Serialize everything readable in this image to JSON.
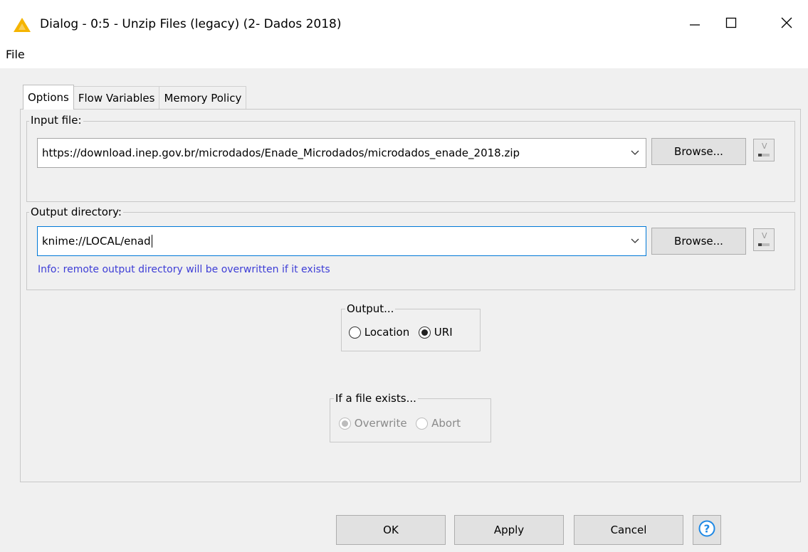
{
  "window": {
    "title": "Dialog - 0:5 - Unzip Files (legacy) (2- Dados 2018)"
  },
  "menu": {
    "file_label": "File"
  },
  "tabs": [
    {
      "label": "Options",
      "active": true
    },
    {
      "label": "Flow Variables",
      "active": false
    },
    {
      "label": "Memory Policy",
      "active": false
    }
  ],
  "input_file": {
    "group_label": "Input file:",
    "value": "https://download.inep.gov.br/microdados/Enade_Microdados/microdados_enade_2018.zip",
    "browse_label": "Browse..."
  },
  "output_directory": {
    "group_label": "Output directory:",
    "value": "knime://LOCAL/enad",
    "browse_label": "Browse...",
    "info": "Info: remote output directory will be overwritten if it exists"
  },
  "output_mode": {
    "group_label": "Output...",
    "options": [
      {
        "label": "Location",
        "checked": false
      },
      {
        "label": "URI",
        "checked": true
      }
    ]
  },
  "file_exists": {
    "group_label": "If a file exists...",
    "options": [
      {
        "label": "Overwrite",
        "checked": true
      },
      {
        "label": "Abort",
        "checked": false
      }
    ],
    "disabled": true
  },
  "footer": {
    "ok_label": "OK",
    "apply_label": "Apply",
    "cancel_label": "Cancel"
  },
  "colors": {
    "info_text": "#3d3dd6",
    "warning_icon": "#f5b400",
    "help_icon": "#1e88e5",
    "focus_border": "#0078d7"
  },
  "icons": {
    "window": "warning-triangle-icon",
    "minimize": "minimize-icon",
    "maximize": "maximize-icon",
    "close": "close-icon",
    "dropdown": "chevron-down-icon",
    "flow_variable": "flow-variable-icon",
    "help": "help-icon"
  }
}
